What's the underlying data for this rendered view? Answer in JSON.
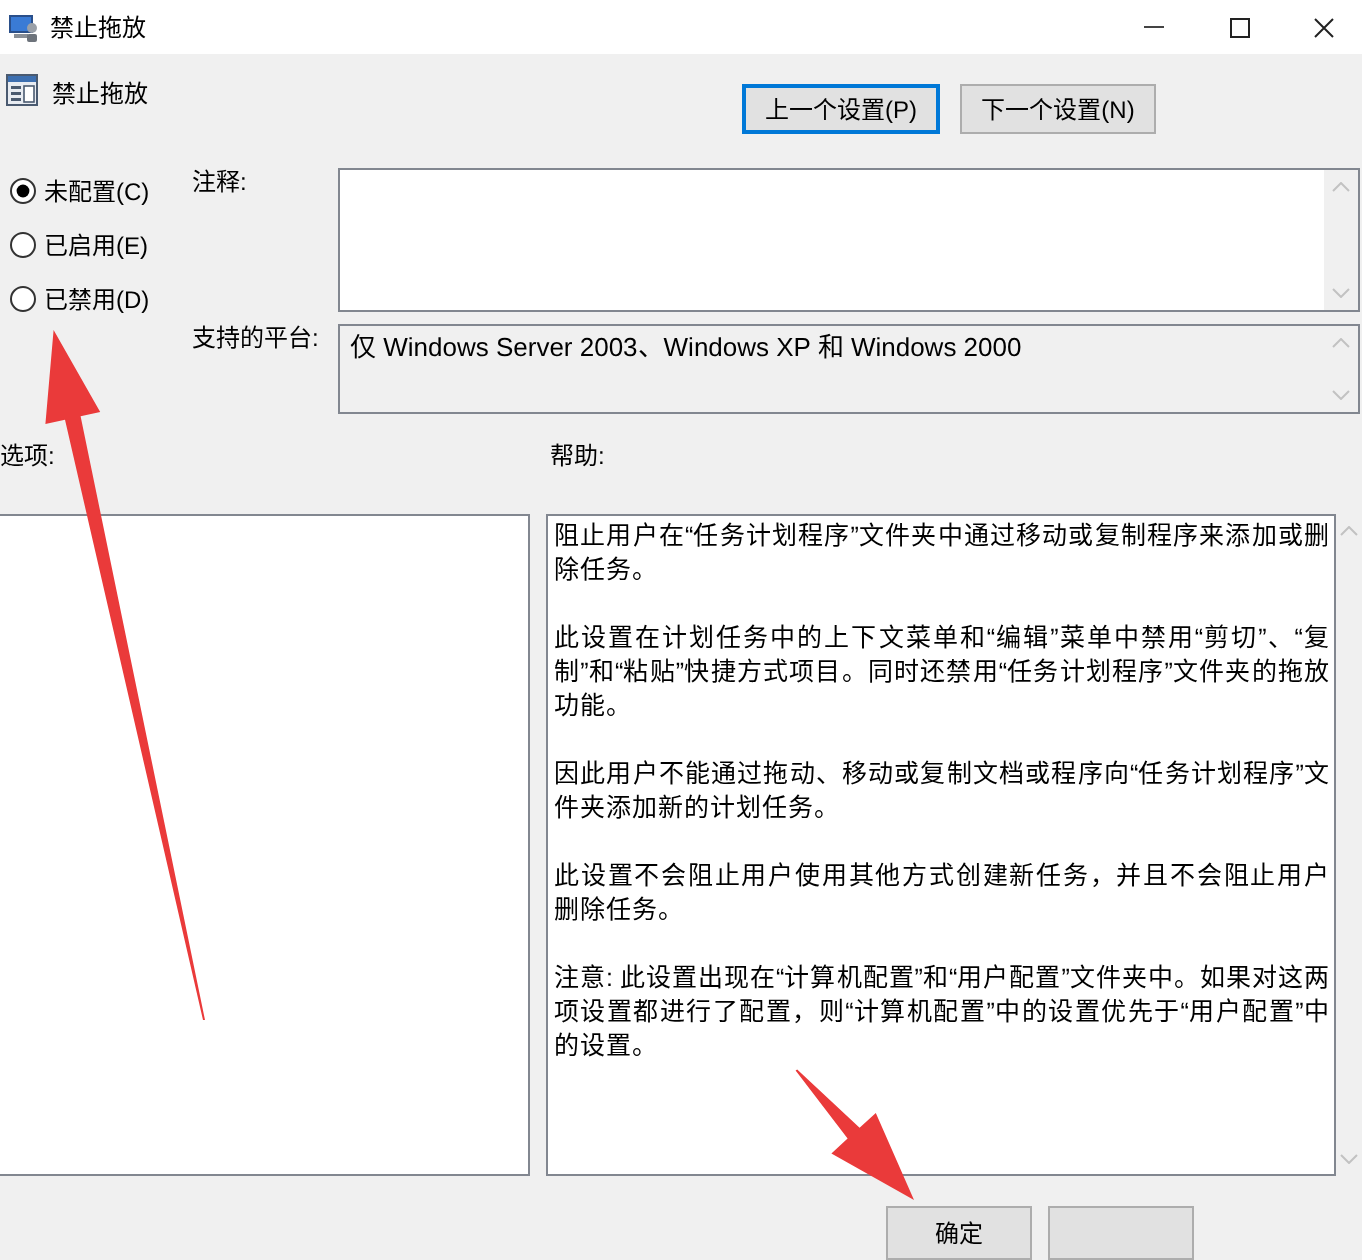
{
  "window": {
    "title": "禁止拖放"
  },
  "setting": {
    "title": "禁止拖放"
  },
  "nav_buttons": [
    {
      "label": "上一个设置(P)",
      "focused": true
    },
    {
      "label": "下一个设置(N)",
      "focused": false
    }
  ],
  "state_options": [
    {
      "label": "未配置(C)",
      "selected": true
    },
    {
      "label": "已启用(E)",
      "selected": false
    },
    {
      "label": "已禁用(D)",
      "selected": false
    }
  ],
  "comment": {
    "label": "注释:"
  },
  "supported_on": {
    "label": "支持的平台:",
    "value": "仅 Windows Server 2003、Windows XP 和 Windows 2000"
  },
  "options": {
    "label": "选项:"
  },
  "help": {
    "label": "帮助:",
    "paragraphs": [
      "阻止用户在“任务计划程序”文件夹中通过移动或复制程序来添加或删除任务。",
      "此设置在计划任务中的上下文菜单和“编辑”菜单中禁用“剪切”、“复制”和“粘贴”快捷方式项目。同时还禁用“任务计划程序”文件夹的拖放功能。",
      "因此用户不能通过拖动、移动或复制文档或程序向“任务计划程序”文件夹添加新的计划任务。",
      "此设置不会阻止用户使用其他方式创建新任务，并且不会阻止用户删除任务。",
      "注意: 此设置出现在“计算机配置”和“用户配置”文件夹中。如果对这两项设置都进行了配置，则“计算机配置”中的设置优先于“用户配置”中的设置。"
    ]
  },
  "dialog_buttons": [
    {
      "kind": "labeled",
      "label": "确定"
    },
    {
      "kind": "blank"
    }
  ]
}
